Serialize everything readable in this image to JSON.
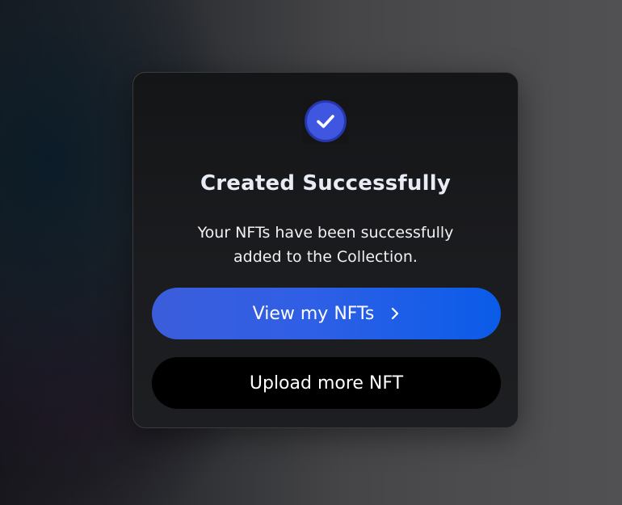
{
  "modal": {
    "status_icon": "check-circle-icon",
    "title": "Created Successfully",
    "message": "Your NFTs have been successfully added to the Collection.",
    "primary_button": {
      "label": "View my NFTs",
      "icon": "chevron-right-icon"
    },
    "secondary_button": {
      "label": "Upload more NFT"
    }
  },
  "colors": {
    "accent": "#3f56e0",
    "primary_button_start": "#3b5ddb",
    "primary_button_end": "#0a5ce8",
    "secondary_button": "#000000",
    "modal_background": "#17181b"
  }
}
